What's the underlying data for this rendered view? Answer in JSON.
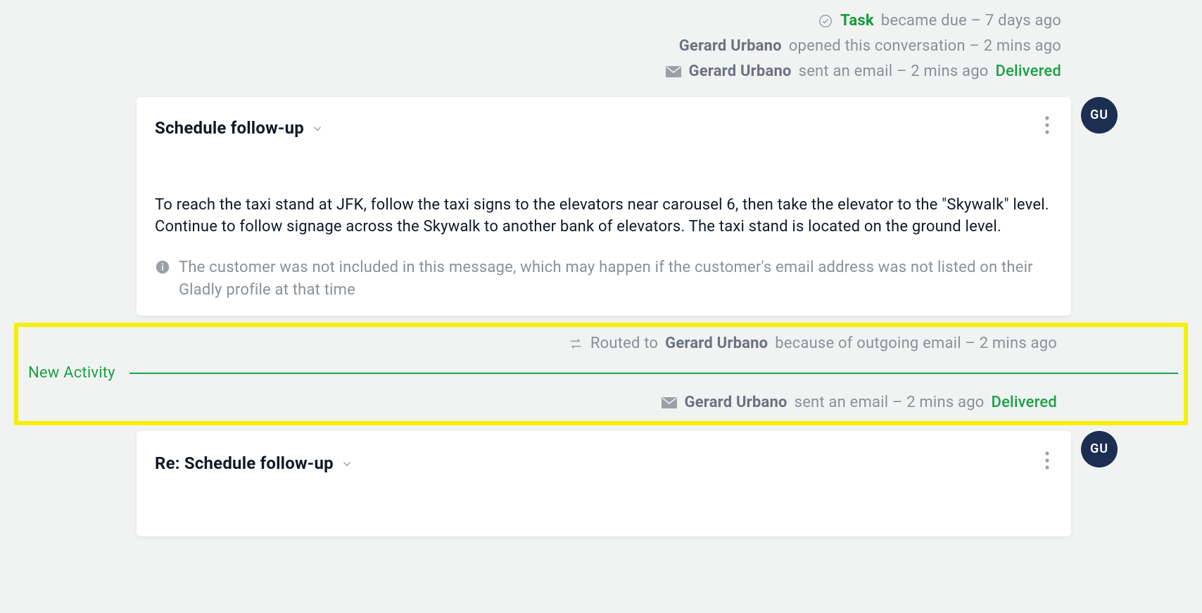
{
  "colors": {
    "accent_green": "#149a3b",
    "link_green": "#1aa142",
    "navy": "#1c2f52",
    "muted": "#8a9097"
  },
  "avatar": {
    "initials": "GU"
  },
  "meta": {
    "task": {
      "label": "Task",
      "text": "became due – 7 days ago"
    },
    "opened": {
      "actor": "Gerard Urbano",
      "text": "opened this conversation – 2 mins ago"
    },
    "sent1": {
      "actor": "Gerard Urbano",
      "text": "sent an email – 2 mins ago",
      "status": "Delivered"
    },
    "routed": {
      "prefix": "Routed to",
      "actor": "Gerard Urbano",
      "text": "because of outgoing email – 2 mins ago"
    },
    "sent2": {
      "actor": "Gerard Urbano",
      "text": "sent an email – 2 mins ago",
      "status": "Delivered"
    }
  },
  "card1": {
    "title": "Schedule follow-up",
    "body": "To reach the taxi stand at JFK, follow the taxi signs to the elevators near carousel 6, then take the elevator to the \"Skywalk\" level. Continue to follow signage across the Skywalk to another bank of elevators. The taxi stand is located on the ground level.",
    "info": "The customer was not included in this message, which may happen if the customer's email address was not listed on their Gladly profile at that time"
  },
  "newActivity": {
    "label": "New Activity"
  },
  "card2": {
    "title": "Re: Schedule follow-up"
  }
}
